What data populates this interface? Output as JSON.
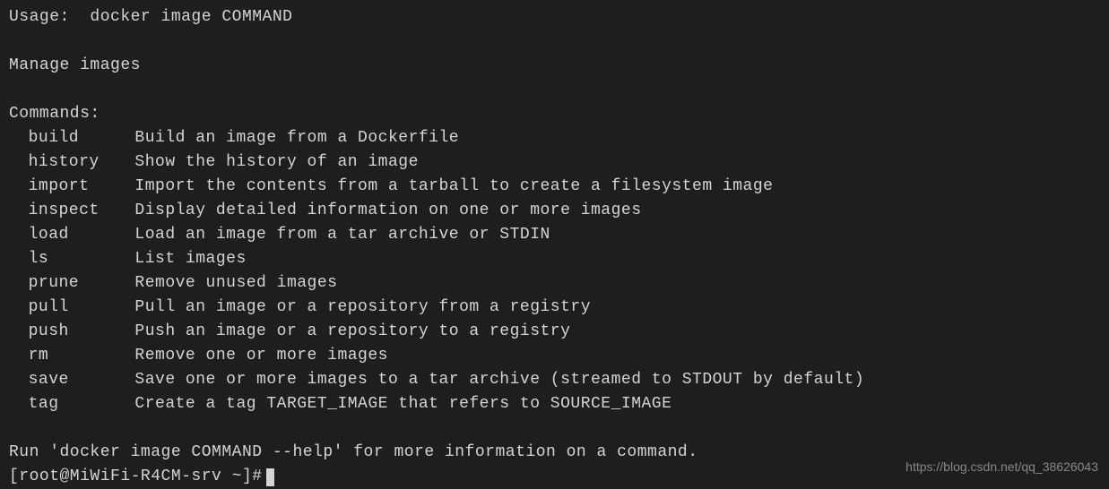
{
  "usage": "Usage:  docker image COMMAND",
  "description": "Manage images",
  "commands_header": "Commands:",
  "commands": [
    {
      "name": "build",
      "desc": "Build an image from a Dockerfile"
    },
    {
      "name": "history",
      "desc": "Show the history of an image"
    },
    {
      "name": "import",
      "desc": "Import the contents from a tarball to create a filesystem image"
    },
    {
      "name": "inspect",
      "desc": "Display detailed information on one or more images"
    },
    {
      "name": "load",
      "desc": "Load an image from a tar archive or STDIN"
    },
    {
      "name": "ls",
      "desc": "List images"
    },
    {
      "name": "prune",
      "desc": "Remove unused images"
    },
    {
      "name": "pull",
      "desc": "Pull an image or a repository from a registry"
    },
    {
      "name": "push",
      "desc": "Push an image or a repository to a registry"
    },
    {
      "name": "rm",
      "desc": "Remove one or more images"
    },
    {
      "name": "save",
      "desc": "Save one or more images to a tar archive (streamed to STDOUT by default)"
    },
    {
      "name": "tag",
      "desc": "Create a tag TARGET_IMAGE that refers to SOURCE_IMAGE"
    }
  ],
  "footer": "Run 'docker image COMMAND --help' for more information on a command.",
  "prompt": "[root@MiWiFi-R4CM-srv ~]# ",
  "watermark": "https://blog.csdn.net/qq_38626043"
}
